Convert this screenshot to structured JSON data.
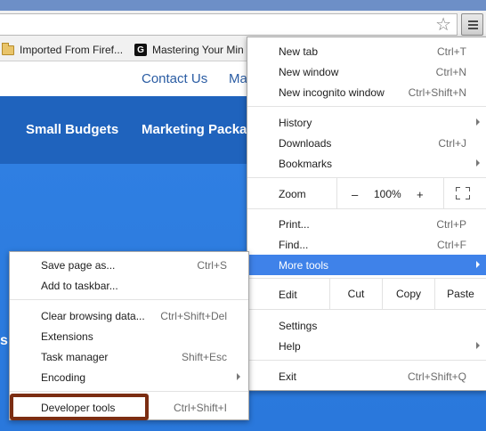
{
  "bookmarks": [
    {
      "label": "Imported From Firef...",
      "icon": "folder-icon"
    },
    {
      "label": "Mastering Your Min",
      "icon": "g-icon",
      "icon_text": "G"
    }
  ],
  "page": {
    "contact": "Contact Us",
    "contact_partial": "Ma",
    "nav": [
      "Small Budgets",
      "Marketing Packa"
    ],
    "hero_text": "s"
  },
  "menu": {
    "new_tab": {
      "label": "New tab",
      "shortcut": "Ctrl+T"
    },
    "new_window": {
      "label": "New window",
      "shortcut": "Ctrl+N"
    },
    "new_incognito": {
      "label": "New incognito window",
      "shortcut": "Ctrl+Shift+N"
    },
    "history": {
      "label": "History"
    },
    "downloads": {
      "label": "Downloads",
      "shortcut": "Ctrl+J"
    },
    "bookmarks": {
      "label": "Bookmarks"
    },
    "zoom": {
      "label": "Zoom",
      "minus": "–",
      "value": "100%",
      "plus": "+"
    },
    "print": {
      "label": "Print...",
      "shortcut": "Ctrl+P"
    },
    "find": {
      "label": "Find...",
      "shortcut": "Ctrl+F"
    },
    "more_tools": {
      "label": "More tools"
    },
    "edit": {
      "label": "Edit",
      "cut": "Cut",
      "copy": "Copy",
      "paste": "Paste"
    },
    "settings": {
      "label": "Settings"
    },
    "help": {
      "label": "Help"
    },
    "exit": {
      "label": "Exit",
      "shortcut": "Ctrl+Shift+Q"
    }
  },
  "submenu": {
    "save_page": {
      "label": "Save page as...",
      "shortcut": "Ctrl+S"
    },
    "add_taskbar": {
      "label": "Add to taskbar..."
    },
    "clear_data": {
      "label": "Clear browsing data...",
      "shortcut": "Ctrl+Shift+Del"
    },
    "extensions": {
      "label": "Extensions"
    },
    "task_manager": {
      "label": "Task manager",
      "shortcut": "Shift+Esc"
    },
    "encoding": {
      "label": "Encoding"
    },
    "dev_tools": {
      "label": "Developer tools",
      "shortcut": "Ctrl+Shift+I"
    }
  },
  "colors": {
    "highlight": "#3f82e9",
    "nav_bg": "#1f63bd",
    "hero_bg": "#2f7fe2",
    "annotation_box": "#7b2d12"
  }
}
